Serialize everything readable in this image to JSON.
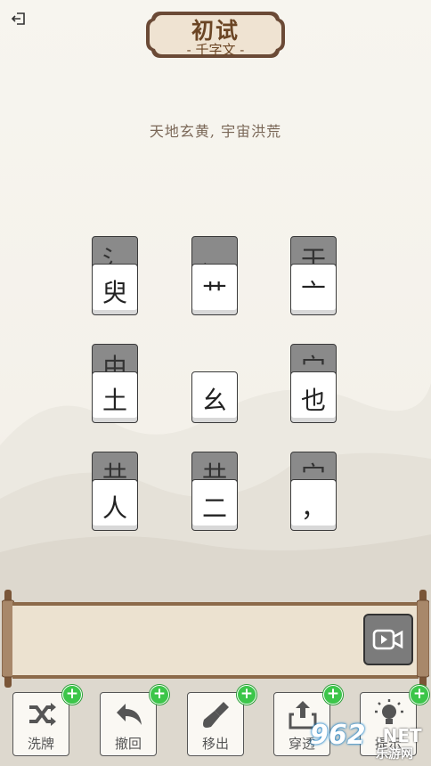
{
  "header": {
    "exit_icon": "exit-icon",
    "title": "初试",
    "subtitle": "- 千字文 -"
  },
  "verse": "天地玄黄, 宇宙洪荒",
  "board": {
    "rows": [
      [
        {
          "back": "氵",
          "front": "臾"
        },
        {
          "back": "、",
          "front": "艹"
        },
        {
          "back": "干",
          "front": "亠"
        }
      ],
      [
        {
          "back": "由",
          "front": "土"
        },
        {
          "back": "",
          "front": "幺"
        },
        {
          "back": "宀",
          "front": "也"
        }
      ],
      [
        {
          "back": "共",
          "front": "人"
        },
        {
          "back": "共",
          "front": "二"
        },
        {
          "back": "宀",
          "front": "，"
        }
      ]
    ]
  },
  "tray": {
    "video_icon": "video-ad-icon"
  },
  "tools": [
    {
      "label": "洗牌",
      "icon": "shuffle-icon"
    },
    {
      "label": "撤回",
      "icon": "undo-icon"
    },
    {
      "label": "移出",
      "icon": "shovel-icon"
    },
    {
      "label": "穿透",
      "icon": "export-icon"
    },
    {
      "label": "提示",
      "icon": "lightbulb-icon"
    }
  ],
  "watermark": {
    "num": "962",
    "net": ".NET",
    "cn": "乐游网"
  },
  "colors": {
    "accent_green": "#3cc64a",
    "wood": "#8c6a4a",
    "tile_back": "#8a8a8a"
  }
}
